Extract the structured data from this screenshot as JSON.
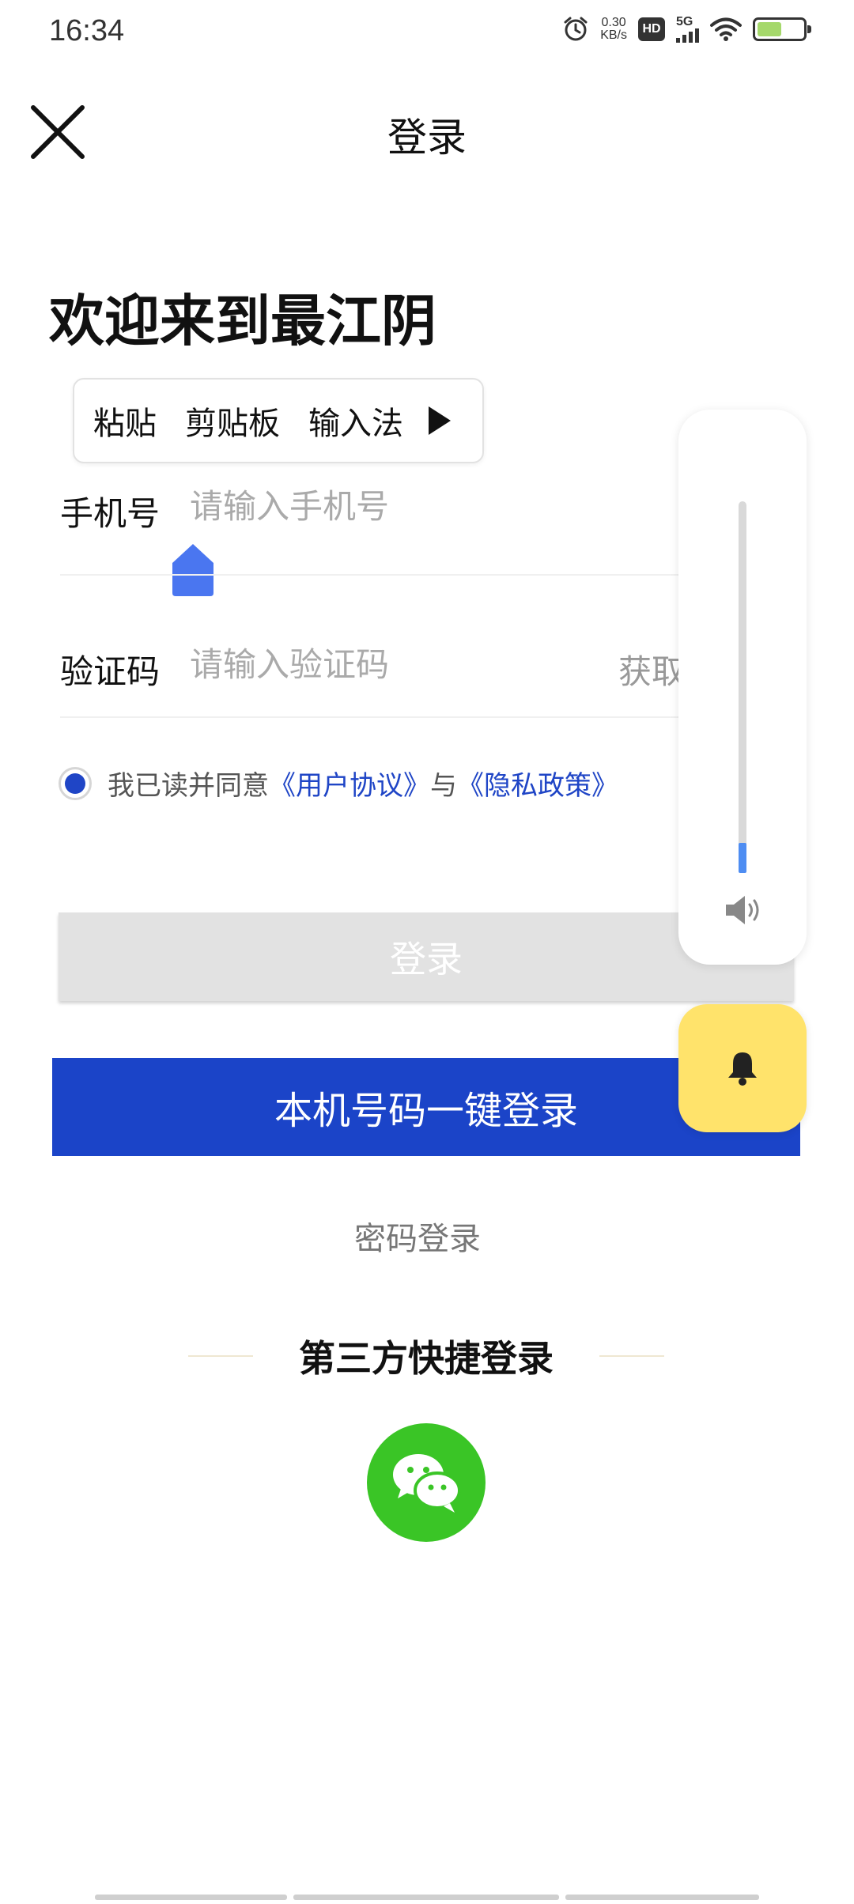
{
  "status_bar": {
    "time": "16:34",
    "net_speed_value": "0.30",
    "net_speed_unit": "KB/s",
    "hd_label": "HD",
    "network_label": "5G",
    "battery_color": "#a5d86b"
  },
  "header": {
    "title": "登录",
    "close_icon": "close-icon"
  },
  "welcome": "欢迎来到最江阴",
  "paste_popup": {
    "items": [
      "粘贴",
      "剪贴板",
      "输入法"
    ],
    "more_icon": "play-arrow-icon"
  },
  "form": {
    "phone_label": "手机号",
    "phone_placeholder": "请输入手机号",
    "phone_value": "",
    "code_label": "验证码",
    "code_placeholder": "请输入验证码",
    "code_value": "",
    "get_code": "获取验证码"
  },
  "agreement": {
    "checked": true,
    "prefix": "我已读并同意",
    "user_agreement": "《用户协议》",
    "connector": "与",
    "privacy_policy": "《隐私政策》"
  },
  "buttons": {
    "login": "登录",
    "one_key_login": "本机号码一键登录",
    "password_login": "密码登录"
  },
  "third_party": {
    "title": "第三方快捷登录",
    "wechat_icon": "wechat-icon"
  },
  "volume": {
    "level_percent": 8,
    "icon": "speaker-icon",
    "ring_icon": "bell-icon"
  },
  "colors": {
    "accent_blue": "#1b44c8",
    "wechat_green": "#3ac526",
    "bell_yellow": "#ffe36b",
    "volume_fill": "#4e8df2"
  }
}
